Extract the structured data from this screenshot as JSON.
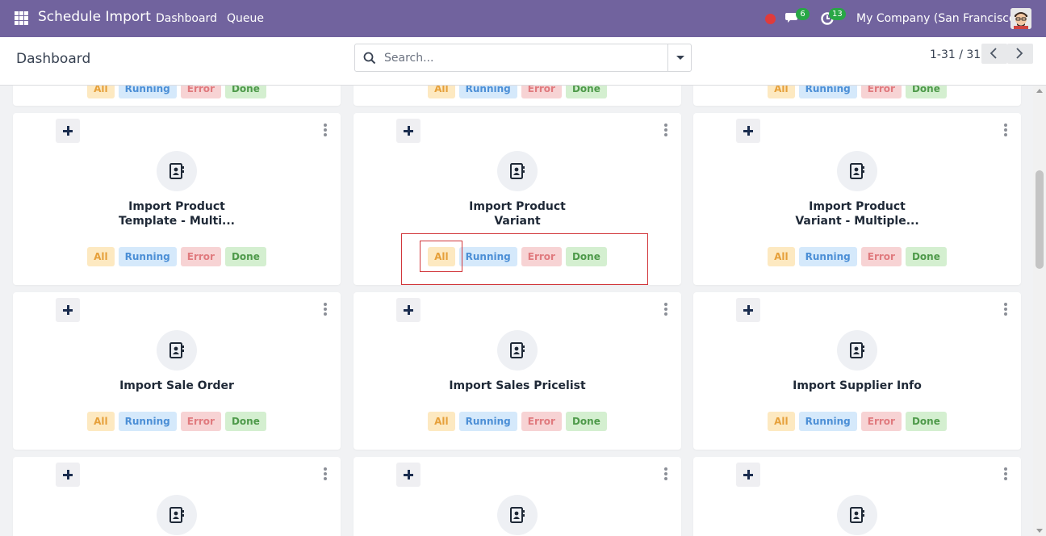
{
  "navbar": {
    "app_title": "Schedule Import",
    "menu": [
      {
        "label": "Dashboard"
      },
      {
        "label": "Queue"
      }
    ],
    "messages_count": "6",
    "activities_count": "13",
    "company": "My Company (San Francisco)"
  },
  "control_panel": {
    "breadcrumb": "Dashboard",
    "search_placeholder": "Search...",
    "pager_value": "1-31 / 31"
  },
  "chips": {
    "all": "All",
    "running": "Running",
    "error": "Error",
    "done": "Done"
  },
  "cards": [
    {
      "title_line1": "Import Product",
      "title_line2": "Template - Multi..."
    },
    {
      "title_line1": "Import Product",
      "title_line2": "Variant"
    },
    {
      "title_line1": "Import Product",
      "title_line2": "Variant - Multiple..."
    },
    {
      "title_line1": "Import Sale Order",
      "title_line2": ""
    },
    {
      "title_line1": "Import Sales Pricelist",
      "title_line2": ""
    },
    {
      "title_line1": "Import Supplier Info",
      "title_line2": ""
    }
  ],
  "colors": {
    "navbar": "#71639e",
    "chip_all": "#fde9c1",
    "chip_running": "#d5e9fb",
    "chip_error": "#f7d3d4",
    "chip_done": "#d4efd0",
    "highlight": "#d1363a"
  }
}
